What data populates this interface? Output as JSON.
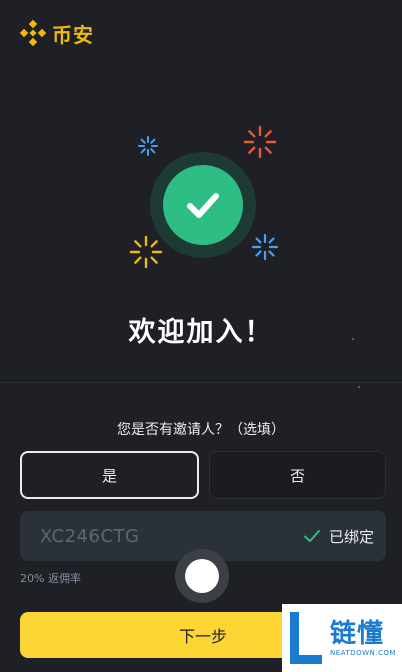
{
  "app": {
    "brand_name": "币安",
    "brand_color": "#f0b90b"
  },
  "welcome": {
    "title": "欢迎加入！"
  },
  "referral": {
    "question": "您是否有邀请人？（选填）",
    "options": [
      {
        "label": "是",
        "selected": true
      },
      {
        "label": "否",
        "selected": false
      }
    ],
    "code": "XC246CTG",
    "bound_label": "已绑定",
    "commission": "20% 返佣率"
  },
  "actions": {
    "next_label": "下一步",
    "primary_color": "#fcd535"
  },
  "watermark": {
    "title": "链懂",
    "subtitle": "NEATDOWN.COM"
  },
  "icons": {
    "brand": "binance-logo-icon",
    "success": "check-circle-icon",
    "bound": "check-icon"
  },
  "colors": {
    "success": "#2ebd85",
    "background": "#1e2026"
  }
}
